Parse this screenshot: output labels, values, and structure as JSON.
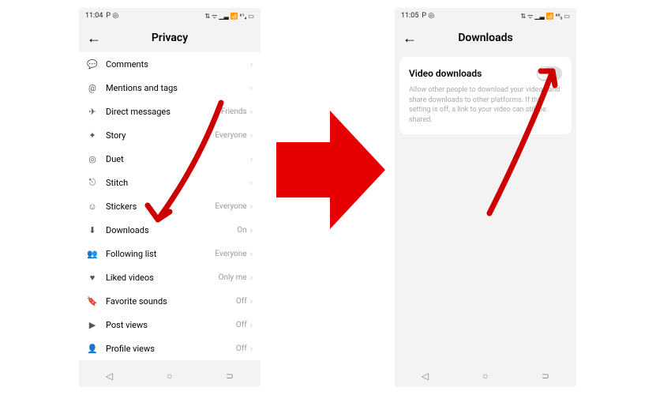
{
  "left": {
    "time": "11:04",
    "timeSuffix": "P ◎",
    "statusIcons": "⇅ ᯤ ▁▃ 📶 ⁶¹₄ ▭",
    "title": "Privacy",
    "items": [
      {
        "icon": "💬",
        "label": "Comments",
        "value": ""
      },
      {
        "icon": "@",
        "label": "Mentions and tags",
        "value": ""
      },
      {
        "icon": "✈",
        "label": "Direct messages",
        "value": "Friends"
      },
      {
        "icon": "✦",
        "label": "Story",
        "value": "Everyone"
      },
      {
        "icon": "◎",
        "label": "Duet",
        "value": ""
      },
      {
        "icon": "⎋",
        "label": "Stitch",
        "value": ""
      },
      {
        "icon": "☺",
        "label": "Stickers",
        "value": "Everyone"
      },
      {
        "icon": "⬇",
        "label": "Downloads",
        "value": "On"
      },
      {
        "icon": "👥",
        "label": "Following list",
        "value": "Everyone"
      },
      {
        "icon": "♥",
        "label": "Liked videos",
        "value": "Only me"
      },
      {
        "icon": "🔖",
        "label": "Favorite sounds",
        "value": "Off"
      },
      {
        "icon": "▶",
        "label": "Post views",
        "value": "Off"
      },
      {
        "icon": "👤",
        "label": "Profile views",
        "value": "Off"
      }
    ]
  },
  "right": {
    "time": "11:05",
    "timeSuffix": "P ◎",
    "statusIcons": "⇅ ᯤ ▁▃ 📶 ⁶⁰₅ ▭",
    "title": "Downloads",
    "card": {
      "title": "Video downloads",
      "desc": "Allow other people to download your videos and share downloads to other platforms. If this setting is off, a link to your video can still be shared."
    }
  }
}
